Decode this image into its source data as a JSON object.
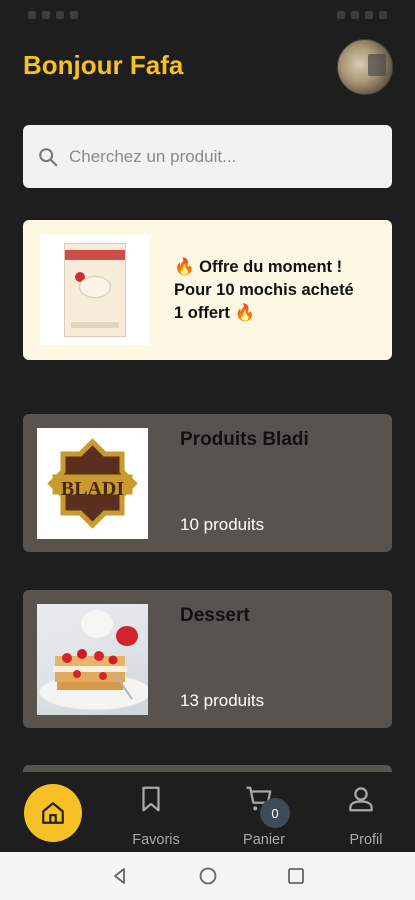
{
  "header": {
    "greeting": "Bonjour Fafa"
  },
  "search": {
    "placeholder": "Cherchez un produit..."
  },
  "promo": {
    "line1": "🔥 Offre du moment !",
    "line2": "Pour 10 mochis acheté",
    "line3": "1 offert 🔥"
  },
  "categories": [
    {
      "title": "Produits Bladi",
      "count": "10 produits",
      "logo_text": "BLADI"
    },
    {
      "title": "Dessert",
      "count": "13 produits"
    }
  ],
  "nav": {
    "favorites": "Favoris",
    "cart": "Panier",
    "cart_count": "0",
    "profile": "Profil"
  },
  "colors": {
    "background": "#1e1e1e",
    "accent": "#f7c125",
    "card": "#57544f",
    "promo_bg": "#fdf8e3"
  },
  "icons": [
    "search-icon",
    "home-icon",
    "bookmark-icon",
    "cart-icon",
    "user-icon",
    "back-icon",
    "home-circle-icon",
    "recents-icon"
  ]
}
